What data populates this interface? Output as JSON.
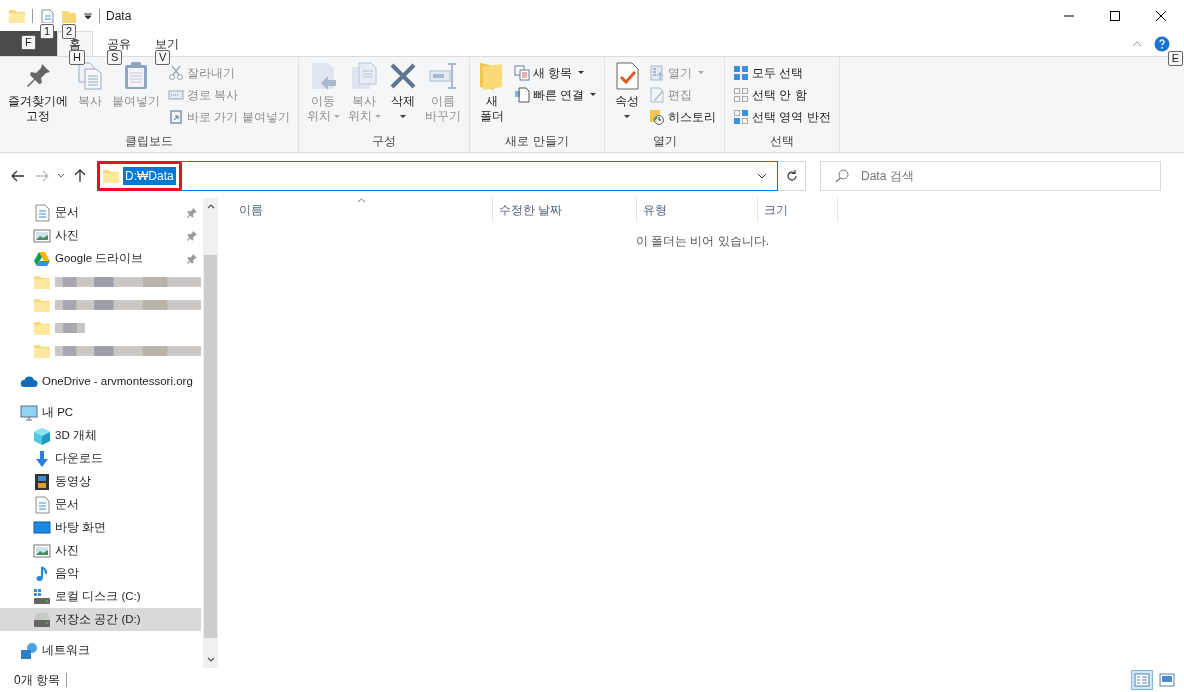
{
  "window": {
    "title": "Data",
    "quick_access_keytips": [
      "1",
      "2"
    ]
  },
  "ribbon": {
    "file_keytip": "F",
    "help_keytip": "E",
    "tabs": [
      {
        "label": "홈",
        "keytip": "H",
        "selected": true
      },
      {
        "label": "공유",
        "keytip": "S",
        "selected": false
      },
      {
        "label": "보기",
        "keytip": "V",
        "selected": false
      }
    ],
    "groups": [
      {
        "name": "클립보드",
        "commands": [
          {
            "kind": "large",
            "lines": [
              "즐겨찾기에",
              "고정"
            ],
            "disabled": false,
            "dropdown": false
          },
          {
            "kind": "large",
            "lines": [
              "복사"
            ],
            "disabled": true,
            "dropdown": false
          },
          {
            "kind": "large",
            "lines": [
              "붙여넣기"
            ],
            "disabled": true,
            "dropdown": false
          },
          {
            "kind": "small",
            "lines": [
              "잘라내기"
            ],
            "disabled": true,
            "dropdown": false
          },
          {
            "kind": "small",
            "lines": [
              "경로 복사"
            ],
            "disabled": true,
            "dropdown": false
          },
          {
            "kind": "small",
            "lines": [
              "바로 가기 붙여넣기"
            ],
            "disabled": true,
            "dropdown": false
          }
        ]
      },
      {
        "name": "구성",
        "commands": [
          {
            "kind": "large",
            "lines": [
              "이동",
              "위치"
            ],
            "disabled": true,
            "dropdown": true
          },
          {
            "kind": "large",
            "lines": [
              "복사",
              "위치"
            ],
            "disabled": true,
            "dropdown": true
          },
          {
            "kind": "large",
            "lines": [
              "삭제"
            ],
            "disabled": false,
            "dropdown": true
          },
          {
            "kind": "large",
            "lines": [
              "이름",
              "바꾸기"
            ],
            "disabled": true,
            "dropdown": false
          }
        ]
      },
      {
        "name": "새로 만들기",
        "commands": [
          {
            "kind": "large",
            "lines": [
              "새",
              "폴더"
            ],
            "disabled": false,
            "dropdown": false
          },
          {
            "kind": "small",
            "lines": [
              "새 항목"
            ],
            "disabled": false,
            "dropdown": true
          },
          {
            "kind": "small",
            "lines": [
              "빠른 연결"
            ],
            "disabled": false,
            "dropdown": true
          }
        ]
      },
      {
        "name": "열기",
        "commands": [
          {
            "kind": "large",
            "lines": [
              "속성"
            ],
            "disabled": false,
            "dropdown": true
          },
          {
            "kind": "small",
            "lines": [
              "열기"
            ],
            "disabled": true,
            "dropdown": true
          },
          {
            "kind": "small",
            "lines": [
              "편집"
            ],
            "disabled": true,
            "dropdown": false
          },
          {
            "kind": "small",
            "lines": [
              "히스토리"
            ],
            "disabled": false,
            "dropdown": false
          }
        ]
      },
      {
        "name": "선택",
        "commands": [
          {
            "kind": "small",
            "lines": [
              "모두 선택"
            ],
            "disabled": false,
            "dropdown": false
          },
          {
            "kind": "small",
            "lines": [
              "선택 안 함"
            ],
            "disabled": false,
            "dropdown": false
          },
          {
            "kind": "small",
            "lines": [
              "선택 영역 반전"
            ],
            "disabled": false,
            "dropdown": false
          }
        ]
      }
    ]
  },
  "address": {
    "path": "D:₩Data",
    "path_selected": true,
    "highlighted": true,
    "search_placeholder": "Data 검색"
  },
  "sidebar": {
    "pinned_items": [
      {
        "kind": "item",
        "label": "문서",
        "pinned": true,
        "selected": false
      },
      {
        "kind": "item",
        "label": "사진",
        "pinned": true,
        "selected": false
      },
      {
        "kind": "item",
        "label": "Google 드라이브",
        "pinned": true,
        "selected": false
      },
      {
        "kind": "redacted",
        "selected": false
      },
      {
        "kind": "redacted",
        "selected": false
      },
      {
        "kind": "redacted",
        "selected": false
      },
      {
        "kind": "redacted",
        "selected": false
      }
    ],
    "items": [
      {
        "label": "OneDrive - arvmontessori.org",
        "selected": false
      },
      {
        "label": "내 PC",
        "selected": false,
        "children": [
          {
            "label": "3D 개체",
            "selected": false
          },
          {
            "label": "다운로드",
            "selected": false
          },
          {
            "label": "동영상",
            "selected": false
          },
          {
            "label": "문서",
            "selected": false
          },
          {
            "label": "바탕 화면",
            "selected": false
          },
          {
            "label": "사진",
            "selected": false
          },
          {
            "label": "음악",
            "selected": false
          },
          {
            "label": "로컬 디스크 (C:)",
            "selected": false
          },
          {
            "label": "저장소 공간 (D:)",
            "selected": true
          }
        ]
      },
      {
        "label": "네트워크",
        "selected": false
      }
    ]
  },
  "table": {
    "columns": [
      {
        "label": "이름",
        "sorted": true
      },
      {
        "label": "수정한 날짜",
        "sorted": false
      },
      {
        "label": "유형",
        "sorted": false
      },
      {
        "label": "크기",
        "sorted": false
      }
    ],
    "empty_message": "이 폴더는 비어 있습니다."
  },
  "status_bar": {
    "item_count": "0개 항목",
    "views": [
      {
        "selected": true
      },
      {
        "selected": false
      }
    ]
  }
}
